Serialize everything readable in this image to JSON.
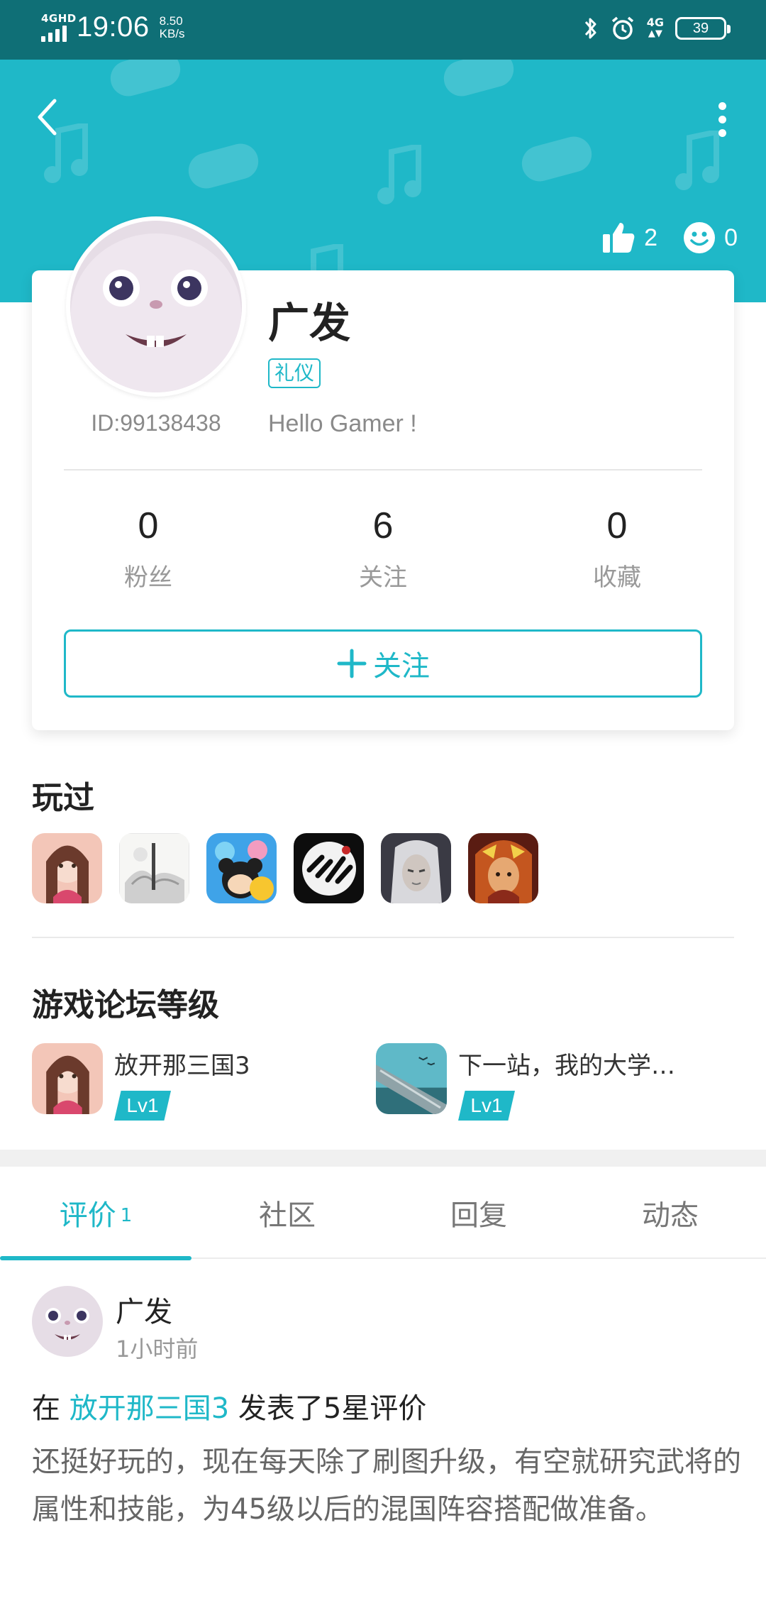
{
  "status_bar": {
    "network_label": "4GHD",
    "time": "19:06",
    "speed_value": "8.50",
    "speed_unit": "KB/s",
    "mobile_label": "4G",
    "battery": "39"
  },
  "header": {
    "likes_count": "2",
    "smile_count": "0"
  },
  "profile": {
    "name": "广发",
    "tag": "礼仪",
    "id_text": "ID:99138438",
    "bio": "Hello Gamer !",
    "stats": [
      {
        "value": "0",
        "label": "粉丝"
      },
      {
        "value": "6",
        "label": "关注"
      },
      {
        "value": "0",
        "label": "收藏"
      }
    ],
    "follow_button_label": "关注"
  },
  "played": {
    "title": "玩过",
    "games": [
      "game-1",
      "game-2",
      "game-3",
      "game-4",
      "game-5",
      "game-6"
    ]
  },
  "forum": {
    "title": "游戏论坛等级",
    "items": [
      {
        "name": "放开那三国3",
        "level": "Lv1"
      },
      {
        "name": "下一站，我的大学…",
        "level": "Lv1"
      }
    ]
  },
  "tabs": [
    {
      "label": "评价",
      "count": "1"
    },
    {
      "label": "社区"
    },
    {
      "label": "回复"
    },
    {
      "label": "动态"
    }
  ],
  "post": {
    "author": "广发",
    "time": "1小时前",
    "prefix": "在",
    "game_link": "放开那三国3",
    "suffix": "发表了5星评价",
    "body": "还挺好玩的，现在每天除了刷图升级，有空就研究武将的属性和技能，为45级以后的混国阵容搭配做准备。"
  },
  "colors": {
    "accent": "#1fb8c8",
    "status_bar": "#0f6f76"
  }
}
